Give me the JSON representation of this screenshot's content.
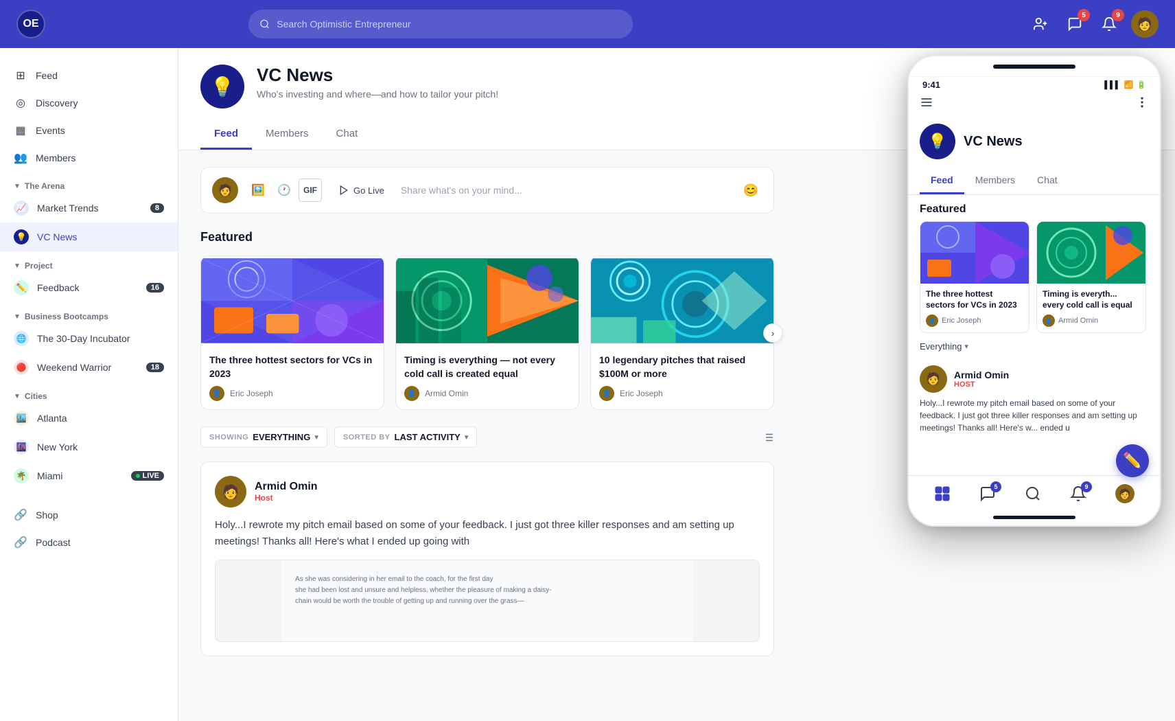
{
  "app": {
    "name": "Optimistic Entrepreneur",
    "logo": "OE",
    "search_placeholder": "Search Optimistic Entrepreneur"
  },
  "topnav": {
    "badges": {
      "notifications": "5",
      "messages": "9"
    }
  },
  "sidebar": {
    "top_items": [
      {
        "id": "feed",
        "label": "Feed",
        "icon": "⊞"
      },
      {
        "id": "discovery",
        "label": "Discovery",
        "icon": "◎"
      },
      {
        "id": "events",
        "label": "Events",
        "icon": "▦"
      },
      {
        "id": "members",
        "label": "Members",
        "icon": "👥"
      }
    ],
    "sections": [
      {
        "id": "the-arena",
        "label": "The Arena",
        "items": [
          {
            "id": "market-trends",
            "label": "Market Trends",
            "badge": "8",
            "icon_color": "#3b82f6",
            "icon": "📈"
          },
          {
            "id": "vc-news",
            "label": "VC News",
            "active": true,
            "icon_color": "#3b3fc4",
            "icon": "💡"
          }
        ]
      },
      {
        "id": "project",
        "label": "Project",
        "items": [
          {
            "id": "feedback",
            "label": "Feedback",
            "badge": "16",
            "icon_color": "#10b981",
            "icon": "✏️"
          }
        ]
      },
      {
        "id": "business-bootcamps",
        "label": "Business Bootcamps",
        "items": [
          {
            "id": "30-day",
            "label": "The 30-Day Incubator",
            "icon_color": "#3b82f6",
            "icon": "🌐"
          },
          {
            "id": "weekend",
            "label": "Weekend Warrior",
            "badge": "18",
            "icon_color": "#ef4444",
            "icon": "🔴"
          }
        ]
      },
      {
        "id": "cities",
        "label": "Cities",
        "items": [
          {
            "id": "atlanta",
            "label": "Atlanta",
            "icon_color": "#f97316",
            "icon": "🏙️"
          },
          {
            "id": "new-york",
            "label": "New York",
            "icon_color": "#6366f1",
            "icon": "🌆"
          },
          {
            "id": "miami",
            "label": "Miami",
            "badge": "LIVE",
            "icon_color": "#10b981",
            "icon": "🌴",
            "live": true
          }
        ]
      }
    ],
    "bottom_items": [
      {
        "id": "shop",
        "label": "Shop",
        "icon": "🔗"
      },
      {
        "id": "podcast",
        "label": "Podcast",
        "icon": "🔗"
      }
    ]
  },
  "group": {
    "logo": "💡",
    "name": "VC News",
    "description": "Who's investing and where—and how to tailor your pitch!",
    "tabs": [
      {
        "id": "feed",
        "label": "Feed",
        "active": true
      },
      {
        "id": "members",
        "label": "Members",
        "active": false
      },
      {
        "id": "chat",
        "label": "Chat",
        "active": false
      }
    ]
  },
  "composer": {
    "placeholder": "Share what's on your mind...",
    "tools": [
      "🖼️",
      "🕐",
      "GIF"
    ],
    "go_live": "Go Live"
  },
  "featured": {
    "title": "Featured",
    "cards": [
      {
        "id": "card-1",
        "title": "The three hottest sectors for VCs in 2023",
        "author": "Eric Joseph"
      },
      {
        "id": "card-2",
        "title": "Timing is everything — not every cold call is created equal",
        "author": "Armid Omin"
      },
      {
        "id": "card-3",
        "title": "10 legendary pitches that raised $100M or more",
        "author": "Eric Joseph"
      }
    ]
  },
  "filter": {
    "showing_label": "SHOWING",
    "showing_value": "EVERYTHING",
    "sorted_label": "SORTED BY",
    "sorted_value": "LAST ACTIVITY"
  },
  "post": {
    "author": "Armid Omin",
    "role": "Host",
    "text": "Holy...I rewrote my pitch email based on some of your feedback. I just got three killer responses and am setting up meetings! Thanks all! Here's what I ended up going with"
  },
  "phone": {
    "time": "9:41",
    "group_name": "VC News",
    "tabs": [
      {
        "label": "Feed",
        "active": true
      },
      {
        "label": "Members",
        "active": false
      },
      {
        "label": "Chat",
        "active": false
      }
    ],
    "featured_title": "Featured",
    "cards": [
      {
        "title": "The three hottest sectors for VCs in 2023",
        "author": "Eric Joseph"
      },
      {
        "title": "Timing is everyth... every cold call is equal",
        "author": "Armid Omin"
      }
    ],
    "filter_label": "Everything",
    "post_author": "Armid Omin",
    "post_role": "HOST",
    "post_text": "Holy...I rewrote my pitch email based on some of your feedback. I just got three killer responses and am setting up meetings! Thanks all! Here's w... ended u",
    "bottom_badges": {
      "messages": "5",
      "notifications": "9"
    }
  }
}
